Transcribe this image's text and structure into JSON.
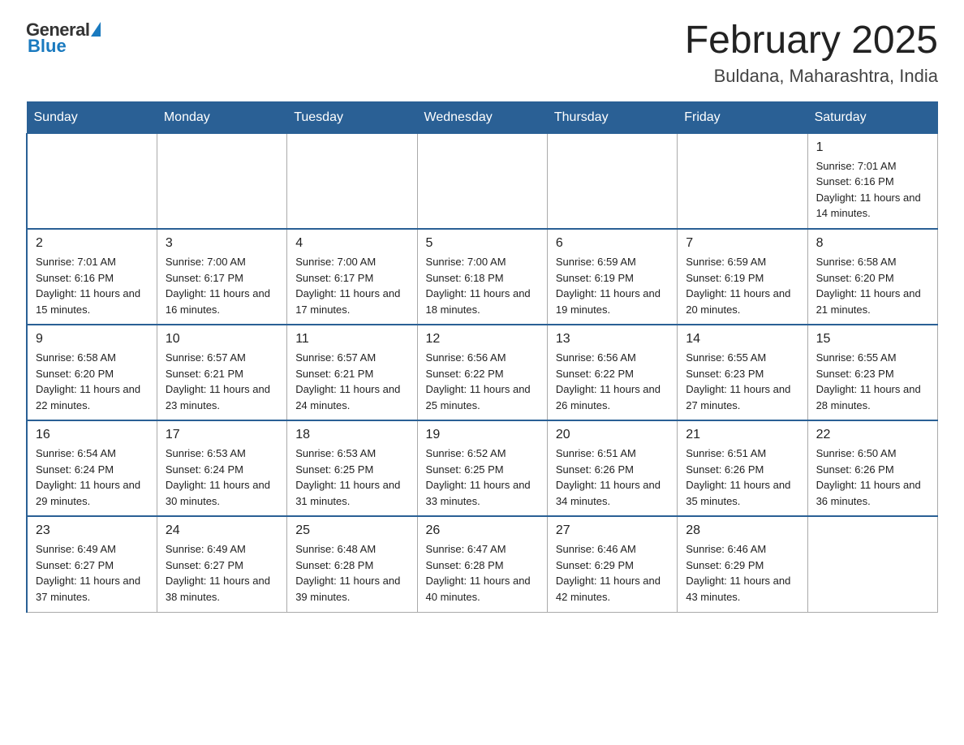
{
  "header": {
    "logo": {
      "general": "General",
      "blue": "Blue"
    },
    "title": "February 2025",
    "location": "Buldana, Maharashtra, India"
  },
  "weekdays": [
    "Sunday",
    "Monday",
    "Tuesday",
    "Wednesday",
    "Thursday",
    "Friday",
    "Saturday"
  ],
  "weeks": [
    [
      {
        "day": "",
        "sunrise": "",
        "sunset": "",
        "daylight": ""
      },
      {
        "day": "",
        "sunrise": "",
        "sunset": "",
        "daylight": ""
      },
      {
        "day": "",
        "sunrise": "",
        "sunset": "",
        "daylight": ""
      },
      {
        "day": "",
        "sunrise": "",
        "sunset": "",
        "daylight": ""
      },
      {
        "day": "",
        "sunrise": "",
        "sunset": "",
        "daylight": ""
      },
      {
        "day": "",
        "sunrise": "",
        "sunset": "",
        "daylight": ""
      },
      {
        "day": "1",
        "sunrise": "Sunrise: 7:01 AM",
        "sunset": "Sunset: 6:16 PM",
        "daylight": "Daylight: 11 hours and 14 minutes."
      }
    ],
    [
      {
        "day": "2",
        "sunrise": "Sunrise: 7:01 AM",
        "sunset": "Sunset: 6:16 PM",
        "daylight": "Daylight: 11 hours and 15 minutes."
      },
      {
        "day": "3",
        "sunrise": "Sunrise: 7:00 AM",
        "sunset": "Sunset: 6:17 PM",
        "daylight": "Daylight: 11 hours and 16 minutes."
      },
      {
        "day": "4",
        "sunrise": "Sunrise: 7:00 AM",
        "sunset": "Sunset: 6:17 PM",
        "daylight": "Daylight: 11 hours and 17 minutes."
      },
      {
        "day": "5",
        "sunrise": "Sunrise: 7:00 AM",
        "sunset": "Sunset: 6:18 PM",
        "daylight": "Daylight: 11 hours and 18 minutes."
      },
      {
        "day": "6",
        "sunrise": "Sunrise: 6:59 AM",
        "sunset": "Sunset: 6:19 PM",
        "daylight": "Daylight: 11 hours and 19 minutes."
      },
      {
        "day": "7",
        "sunrise": "Sunrise: 6:59 AM",
        "sunset": "Sunset: 6:19 PM",
        "daylight": "Daylight: 11 hours and 20 minutes."
      },
      {
        "day": "8",
        "sunrise": "Sunrise: 6:58 AM",
        "sunset": "Sunset: 6:20 PM",
        "daylight": "Daylight: 11 hours and 21 minutes."
      }
    ],
    [
      {
        "day": "9",
        "sunrise": "Sunrise: 6:58 AM",
        "sunset": "Sunset: 6:20 PM",
        "daylight": "Daylight: 11 hours and 22 minutes."
      },
      {
        "day": "10",
        "sunrise": "Sunrise: 6:57 AM",
        "sunset": "Sunset: 6:21 PM",
        "daylight": "Daylight: 11 hours and 23 minutes."
      },
      {
        "day": "11",
        "sunrise": "Sunrise: 6:57 AM",
        "sunset": "Sunset: 6:21 PM",
        "daylight": "Daylight: 11 hours and 24 minutes."
      },
      {
        "day": "12",
        "sunrise": "Sunrise: 6:56 AM",
        "sunset": "Sunset: 6:22 PM",
        "daylight": "Daylight: 11 hours and 25 minutes."
      },
      {
        "day": "13",
        "sunrise": "Sunrise: 6:56 AM",
        "sunset": "Sunset: 6:22 PM",
        "daylight": "Daylight: 11 hours and 26 minutes."
      },
      {
        "day": "14",
        "sunrise": "Sunrise: 6:55 AM",
        "sunset": "Sunset: 6:23 PM",
        "daylight": "Daylight: 11 hours and 27 minutes."
      },
      {
        "day": "15",
        "sunrise": "Sunrise: 6:55 AM",
        "sunset": "Sunset: 6:23 PM",
        "daylight": "Daylight: 11 hours and 28 minutes."
      }
    ],
    [
      {
        "day": "16",
        "sunrise": "Sunrise: 6:54 AM",
        "sunset": "Sunset: 6:24 PM",
        "daylight": "Daylight: 11 hours and 29 minutes."
      },
      {
        "day": "17",
        "sunrise": "Sunrise: 6:53 AM",
        "sunset": "Sunset: 6:24 PM",
        "daylight": "Daylight: 11 hours and 30 minutes."
      },
      {
        "day": "18",
        "sunrise": "Sunrise: 6:53 AM",
        "sunset": "Sunset: 6:25 PM",
        "daylight": "Daylight: 11 hours and 31 minutes."
      },
      {
        "day": "19",
        "sunrise": "Sunrise: 6:52 AM",
        "sunset": "Sunset: 6:25 PM",
        "daylight": "Daylight: 11 hours and 33 minutes."
      },
      {
        "day": "20",
        "sunrise": "Sunrise: 6:51 AM",
        "sunset": "Sunset: 6:26 PM",
        "daylight": "Daylight: 11 hours and 34 minutes."
      },
      {
        "day": "21",
        "sunrise": "Sunrise: 6:51 AM",
        "sunset": "Sunset: 6:26 PM",
        "daylight": "Daylight: 11 hours and 35 minutes."
      },
      {
        "day": "22",
        "sunrise": "Sunrise: 6:50 AM",
        "sunset": "Sunset: 6:26 PM",
        "daylight": "Daylight: 11 hours and 36 minutes."
      }
    ],
    [
      {
        "day": "23",
        "sunrise": "Sunrise: 6:49 AM",
        "sunset": "Sunset: 6:27 PM",
        "daylight": "Daylight: 11 hours and 37 minutes."
      },
      {
        "day": "24",
        "sunrise": "Sunrise: 6:49 AM",
        "sunset": "Sunset: 6:27 PM",
        "daylight": "Daylight: 11 hours and 38 minutes."
      },
      {
        "day": "25",
        "sunrise": "Sunrise: 6:48 AM",
        "sunset": "Sunset: 6:28 PM",
        "daylight": "Daylight: 11 hours and 39 minutes."
      },
      {
        "day": "26",
        "sunrise": "Sunrise: 6:47 AM",
        "sunset": "Sunset: 6:28 PM",
        "daylight": "Daylight: 11 hours and 40 minutes."
      },
      {
        "day": "27",
        "sunrise": "Sunrise: 6:46 AM",
        "sunset": "Sunset: 6:29 PM",
        "daylight": "Daylight: 11 hours and 42 minutes."
      },
      {
        "day": "28",
        "sunrise": "Sunrise: 6:46 AM",
        "sunset": "Sunset: 6:29 PM",
        "daylight": "Daylight: 11 hours and 43 minutes."
      },
      {
        "day": "",
        "sunrise": "",
        "sunset": "",
        "daylight": ""
      }
    ]
  ]
}
